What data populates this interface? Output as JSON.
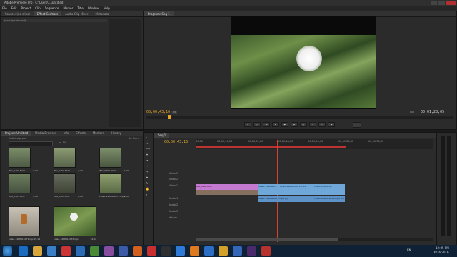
{
  "app": {
    "title": "Adobe Premiere Pro - C:\\Users\\...\\Untitled",
    "menu": [
      "File",
      "Edit",
      "Project",
      "Clip",
      "Sequence",
      "Marker",
      "Title",
      "Window",
      "Help"
    ]
  },
  "source_panel": {
    "tabs": [
      "Source: (no clips)",
      "Effect Controls",
      "Audio Clip Mixer",
      "Metadata"
    ],
    "label": "(no clip selected)"
  },
  "program_monitor": {
    "tab": "Program: Seq 1",
    "timecode": "00;00;43;16",
    "zoom": "Fit",
    "full": "Full",
    "duration": "00;01;20;05"
  },
  "project_panel": {
    "tabs": [
      "Project: Untitled",
      "Media Browser",
      "Info",
      "Effects",
      "Markers",
      "History"
    ],
    "project_name": "Untitled.prproj",
    "item_count": "16 Items",
    "search_placeholder": "",
    "in_label": "In: All",
    "items": [
      {
        "name": "IMG_0460.MOV",
        "duration": "0;00"
      },
      {
        "name": "IMG_0461.MOV",
        "duration": "0;00"
      },
      {
        "name": "IMG_0462.MOV",
        "duration": "0;00"
      },
      {
        "name": "IMG_0463.MOV",
        "duration": "0;00"
      },
      {
        "name": "IMG_0464.MOV",
        "duration": "0;00"
      },
      {
        "name": "video-1468916071.mp4",
        "duration": "0;00"
      },
      {
        "name": "video-1468916071.mp4",
        "duration": "15;14"
      },
      {
        "name": "video-1468916037.mp4",
        "duration": "14;22"
      }
    ]
  },
  "timeline": {
    "tab": "Seq 1",
    "timecode": "00;00;43;16",
    "ruler": [
      "00;00",
      "00;00;16;00",
      "00;00;32;00",
      "00;00;48;00",
      "00;01;04;00",
      "00;01;20;02",
      "00;01;36;02"
    ],
    "tracks": [
      "Video 3",
      "Video 2",
      "Video 1",
      "Audio 1",
      "Audio 2",
      "Audio 3",
      "Master"
    ],
    "clip_labels": {
      "v1a": "IMG_0460.MOV",
      "v1b": "video-1468916...",
      "v1c": "video-1468916071.mp4",
      "v1d": "video-14689160",
      "a1a": "video-1468916071.mp4 [A]",
      "a1b": "video-1468916071.mp4 [A]"
    }
  },
  "status": {
    "text": "Drag edge to trim the selection. Use Alt and Ctrl for other options."
  },
  "taskbar": {
    "lang": "EN",
    "time": "12:05 PM",
    "date": "6/26/2016"
  }
}
